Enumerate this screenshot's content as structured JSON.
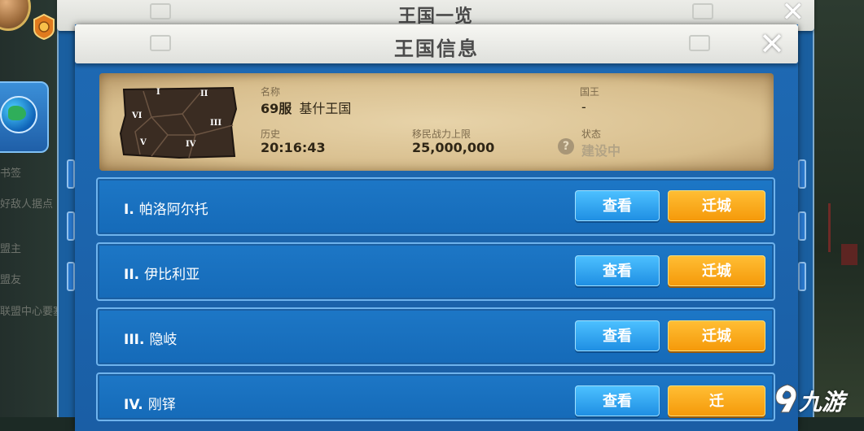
{
  "background": {
    "side_menu_items": [
      "书签",
      "好敌人据点",
      "盟主",
      "盟友",
      "联盟中心要塞"
    ]
  },
  "back_dialog": {
    "title": "王国一览",
    "close_icon": "close-icon"
  },
  "dialog": {
    "title": "王国信息",
    "close_icon": "close-icon"
  },
  "kingdom_info": {
    "map_regions": [
      "I",
      "II",
      "III",
      "IV",
      "V",
      "VI"
    ],
    "name_label": "名称",
    "server": "69服",
    "name": "基什王国",
    "king_label": "国王",
    "king_value": "-",
    "history_label": "历史",
    "history_value": "20:16:43",
    "migration_label": "移民战力上限",
    "migration_value": "25,000,000",
    "status_label": "状态",
    "status_value": "建设中",
    "help_icon": "question-icon"
  },
  "regions": [
    {
      "numeral": "I.",
      "name": "帕洛阿尔托",
      "view_label": "查看",
      "migrate_label": "迁城"
    },
    {
      "numeral": "II.",
      "name": "伊比利亚",
      "view_label": "查看",
      "migrate_label": "迁城"
    },
    {
      "numeral": "III.",
      "name": "隐岐",
      "view_label": "查看",
      "migrate_label": "迁城"
    },
    {
      "numeral": "IV.",
      "name": "刚铎",
      "view_label": "查看",
      "migrate_label": "迁"
    }
  ],
  "watermark": {
    "text": "九游"
  },
  "colors": {
    "primary_blue": "#1d77c6",
    "view_button": "#1f8fe3",
    "migrate_button": "#f59a0a",
    "parchment": "#d7bd8c"
  }
}
